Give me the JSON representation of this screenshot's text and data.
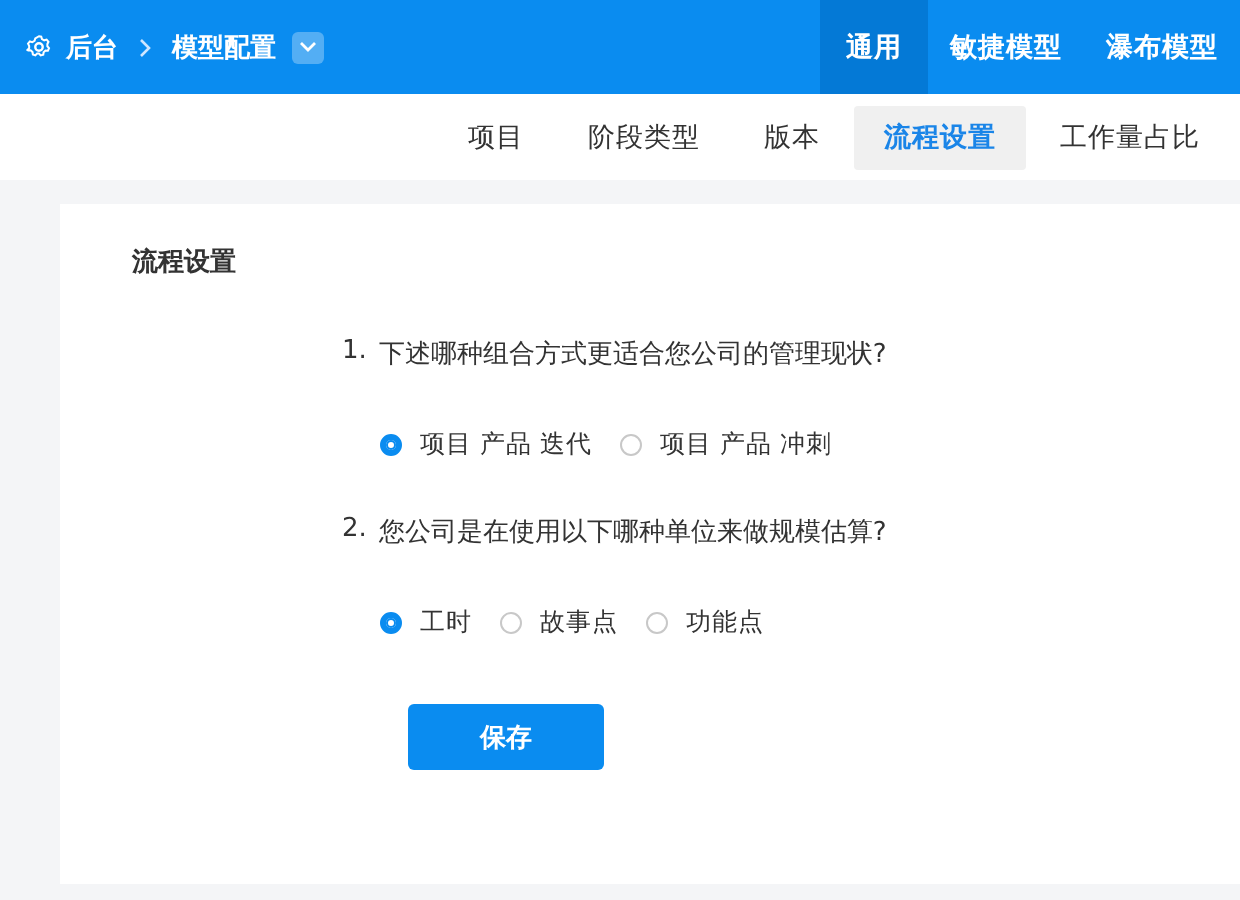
{
  "breadcrumb": {
    "root": "后台",
    "current": "模型配置"
  },
  "top_tabs": [
    {
      "label": "通用",
      "selected": true
    },
    {
      "label": "敏捷模型",
      "selected": false
    },
    {
      "label": "瀑布模型",
      "selected": false
    }
  ],
  "sub_tabs": [
    {
      "label": "项目",
      "selected": false
    },
    {
      "label": "阶段类型",
      "selected": false
    },
    {
      "label": "版本",
      "selected": false
    },
    {
      "label": "流程设置",
      "selected": true
    },
    {
      "label": "工作量占比",
      "selected": false
    }
  ],
  "panel": {
    "title": "流程设置",
    "questions": [
      {
        "number": "1.",
        "text": "下述哪种组合方式更适合您公司的管理现状?",
        "options": [
          {
            "label": "项目 产品 迭代",
            "selected": true
          },
          {
            "label": "项目 产品 冲刺",
            "selected": false
          }
        ]
      },
      {
        "number": "2.",
        "text": "您公司是在使用以下哪种单位来做规模估算?",
        "options": [
          {
            "label": "工时",
            "selected": true
          },
          {
            "label": "故事点",
            "selected": false
          },
          {
            "label": "功能点",
            "selected": false
          }
        ]
      }
    ],
    "save_button": "保存"
  }
}
